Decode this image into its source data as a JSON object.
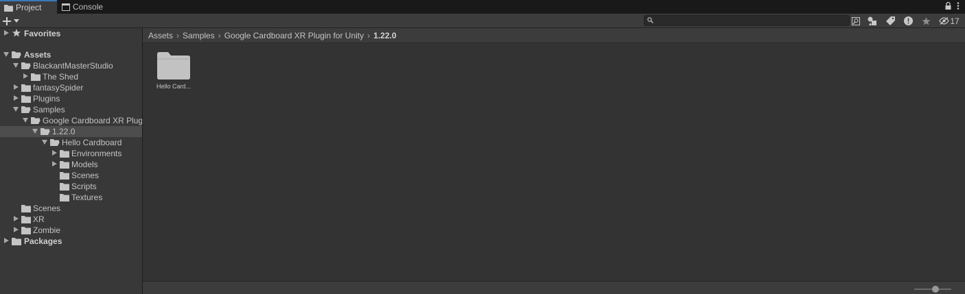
{
  "tabs": [
    {
      "label": "Project",
      "icon": "folder-icon",
      "active": true
    },
    {
      "label": "Console",
      "icon": "console-icon",
      "active": false
    }
  ],
  "toolbar": {
    "add_icon": "plus-icon",
    "search_value": "",
    "hidden_count": "17"
  },
  "tree": {
    "favorites": "Favorites",
    "assets": "Assets",
    "items": [
      {
        "label": "BlackantMasterStudio"
      },
      {
        "label": "The Shed"
      },
      {
        "label": "fantasySpider"
      },
      {
        "label": "Plugins"
      },
      {
        "label": "Samples"
      },
      {
        "label": "Google Cardboard XR Plugin for Unity"
      },
      {
        "label": "1.22.0"
      },
      {
        "label": "Hello Cardboard"
      },
      {
        "label": "Environments"
      },
      {
        "label": "Models"
      },
      {
        "label": "Scenes"
      },
      {
        "label": "Scripts"
      },
      {
        "label": "Textures"
      },
      {
        "label": "Scenes"
      },
      {
        "label": "XR"
      },
      {
        "label": "Zombie"
      }
    ],
    "packages": "Packages"
  },
  "breadcrumb": [
    "Assets",
    "Samples",
    "Google Cardboard XR Plugin for Unity",
    "1.22.0"
  ],
  "assets_grid": [
    {
      "label": "Hello Card...",
      "icon": "folder-icon"
    }
  ],
  "colors": {
    "accent": "#3a79bb",
    "panel": "#383838",
    "content": "#333333",
    "selected_row": "#4d4d4d"
  }
}
